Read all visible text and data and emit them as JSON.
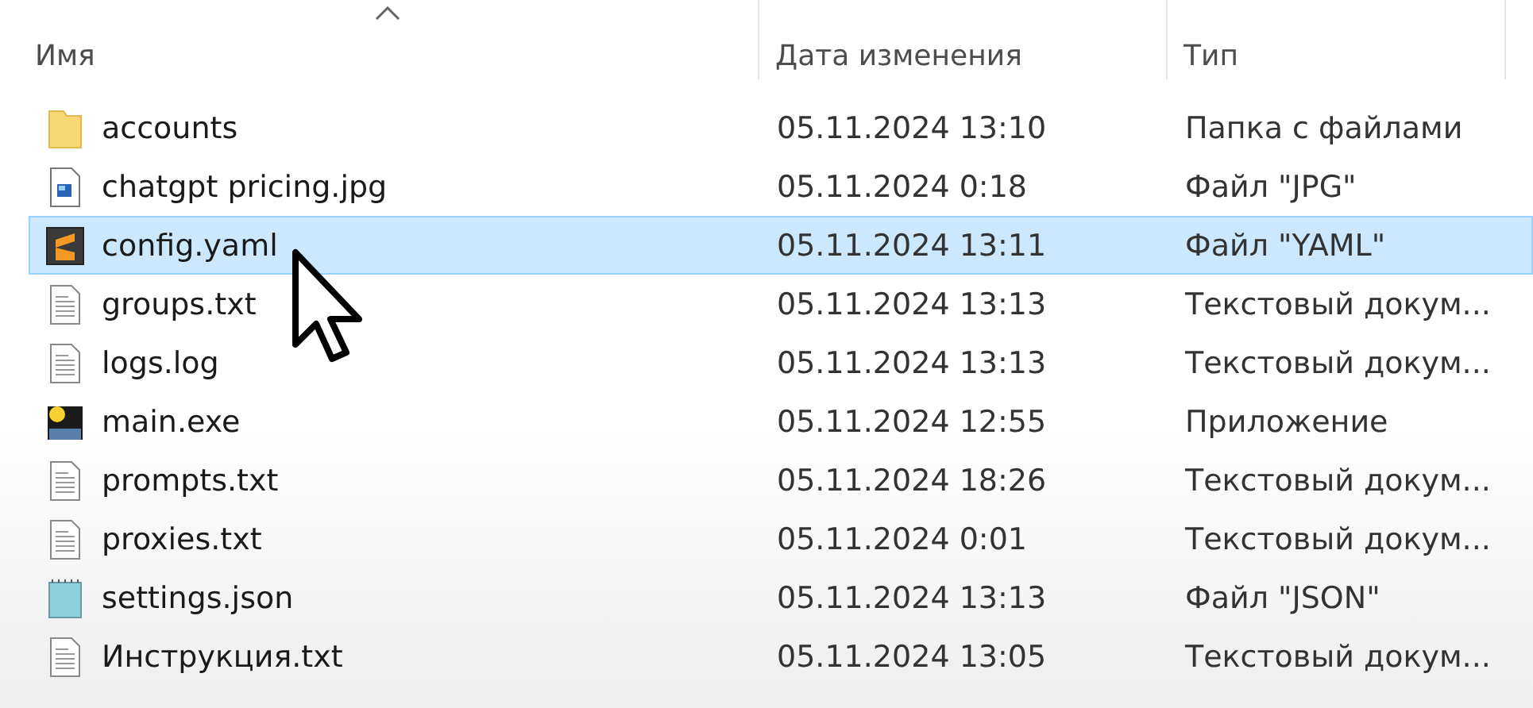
{
  "columns": [
    {
      "label": "Имя",
      "sorted": true
    },
    {
      "label": "Дата изменения",
      "sorted": false
    },
    {
      "label": "Тип",
      "sorted": false
    }
  ],
  "files": [
    {
      "name": "accounts",
      "date": "05.11.2024 13:10",
      "type": "Папка с файлами",
      "kind": "folder",
      "selected": false
    },
    {
      "name": "chatgpt pricing.jpg",
      "date": "05.11.2024 0:18",
      "type": "Файл \"JPG\"",
      "kind": "image",
      "selected": false
    },
    {
      "name": "config.yaml",
      "date": "05.11.2024 13:11",
      "type": "Файл \"YAML\"",
      "kind": "editor",
      "selected": true
    },
    {
      "name": "groups.txt",
      "date": "05.11.2024 13:13",
      "type": "Текстовый докум...",
      "kind": "text",
      "selected": false
    },
    {
      "name": "logs.log",
      "date": "05.11.2024 13:13",
      "type": "Текстовый докум...",
      "kind": "text",
      "selected": false
    },
    {
      "name": "main.exe",
      "date": "05.11.2024 12:55",
      "type": "Приложение",
      "kind": "exe",
      "selected": false
    },
    {
      "name": "prompts.txt",
      "date": "05.11.2024 18:26",
      "type": "Текстовый докум...",
      "kind": "text",
      "selected": false
    },
    {
      "name": "proxies.txt",
      "date": "05.11.2024 0:01",
      "type": "Текстовый докум...",
      "kind": "text",
      "selected": false
    },
    {
      "name": "settings.json",
      "date": "05.11.2024 13:13",
      "type": "Файл \"JSON\"",
      "kind": "json",
      "selected": false
    },
    {
      "name": "Инструкция.txt",
      "date": "05.11.2024 13:05",
      "type": "Текстовый докум...",
      "kind": "text",
      "selected": false
    }
  ]
}
